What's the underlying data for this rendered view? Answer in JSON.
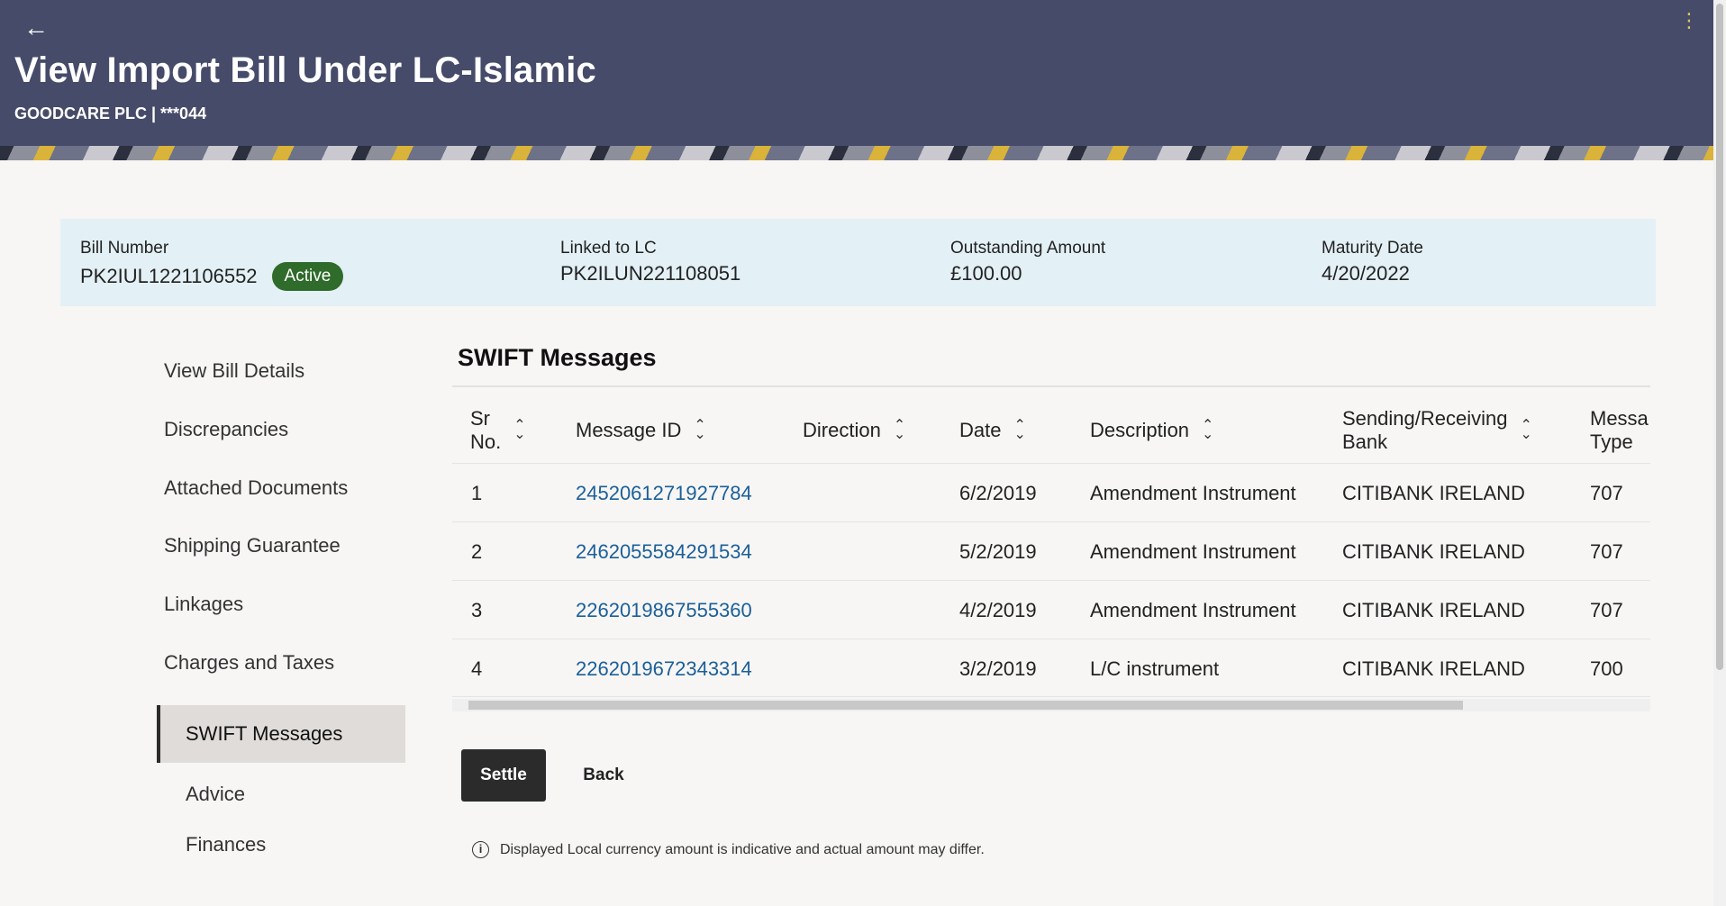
{
  "header": {
    "title": "View Import Bill Under LC-Islamic",
    "subtitle": "GOODCARE PLC | ***044",
    "back_icon": "arrow-left-icon",
    "menu_icon": "kebab-menu-icon"
  },
  "summary": {
    "bill_number_label": "Bill Number",
    "bill_number": "PK2IUL1221106552",
    "status": "Active",
    "linked_lc_label": "Linked to LC",
    "linked_lc": "PK2ILUN221108051",
    "outstanding_label": "Outstanding Amount",
    "outstanding": "£100.00",
    "maturity_label": "Maturity Date",
    "maturity": "4/20/2022"
  },
  "nav": {
    "items": [
      {
        "label": "View Bill Details"
      },
      {
        "label": "Discrepancies"
      },
      {
        "label": "Attached Documents"
      },
      {
        "label": "Shipping Guarantee"
      },
      {
        "label": "Linkages"
      },
      {
        "label": "Charges and Taxes"
      },
      {
        "label": "SWIFT Messages",
        "active": true
      },
      {
        "label": "Advice"
      },
      {
        "label": "Finances"
      }
    ]
  },
  "swift": {
    "title": "SWIFT Messages",
    "columns": {
      "sr_line1": "Sr",
      "sr_line2": "No.",
      "message_id": "Message ID",
      "direction": "Direction",
      "date": "Date",
      "description": "Description",
      "bank_line1": "Sending/Receiving",
      "bank_line2": "Bank",
      "type_line1": "Messa",
      "type_line2": "Type"
    },
    "rows": [
      {
        "sr": "1",
        "message_id": "2452061271927784",
        "direction": "",
        "date": "6/2/2019",
        "description": "Amendment Instrument",
        "bank": "CITIBANK IRELAND",
        "type": "707"
      },
      {
        "sr": "2",
        "message_id": "2462055584291534",
        "direction": "",
        "date": "5/2/2019",
        "description": "Amendment Instrument",
        "bank": "CITIBANK IRELAND",
        "type": "707"
      },
      {
        "sr": "3",
        "message_id": "2262019867555360",
        "direction": "",
        "date": "4/2/2019",
        "description": "Amendment Instrument",
        "bank": "CITIBANK IRELAND",
        "type": "707"
      },
      {
        "sr": "4",
        "message_id": "2262019672343314",
        "direction": "",
        "date": "3/2/2019",
        "description": "L/C instrument",
        "bank": "CITIBANK IRELAND",
        "type": "700"
      }
    ]
  },
  "actions": {
    "settle_label": "Settle",
    "back_label": "Back"
  },
  "note": {
    "icon": "info-icon",
    "text": "Displayed Local currency amount is indicative and actual amount may differ."
  },
  "colors": {
    "header_bg": "#464b6a",
    "summary_bg": "#e3f0f6",
    "badge_bg": "#2f6b2a",
    "link": "#1b5f9a",
    "primary_button": "#2b2b2b"
  }
}
